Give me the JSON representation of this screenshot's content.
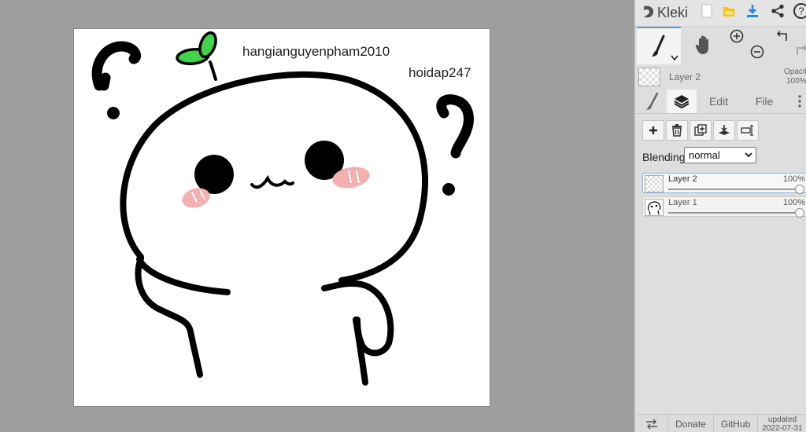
{
  "canvas": {
    "text_1": "hangianguyenpham2010",
    "text_2": "hoidap247"
  },
  "app": {
    "name": "Kleki"
  },
  "topbar": {
    "icons": [
      "new-file-icon",
      "save-icon",
      "download-icon",
      "share-icon",
      "help-icon"
    ]
  },
  "tools": {
    "items": [
      "brush-icon",
      "hand-icon",
      "zoom-in-icon",
      "zoom-out-icon",
      "undo-icon",
      "redo-icon"
    ]
  },
  "current_layer": {
    "name": "Layer 2",
    "opacity_label": "Opacit",
    "opacity_value": "100%"
  },
  "tabs": {
    "edit": "Edit",
    "file": "File"
  },
  "layers_panel": {
    "blending_label": "Blending",
    "blending_value": "normal",
    "layers": [
      {
        "name": "Layer 2",
        "opacity": "100%",
        "opacity_fraction": 1.0
      },
      {
        "name": "Layer 1",
        "opacity": "100%",
        "opacity_fraction": 1.0
      }
    ]
  },
  "footer": {
    "donate": "Donate",
    "github": "GitHub",
    "updated_label": "updated",
    "updated_date": "2022-07-31"
  },
  "colors": {
    "workspace_bg": "#9e9e9e",
    "panel_bg": "#dedede",
    "accent": "#5b9bd5",
    "download_blue": "#1e88e5",
    "save_yellow": "#f4c20d",
    "sprout_green": "#3fd44a",
    "blush_pink": "#f4b0b0"
  }
}
